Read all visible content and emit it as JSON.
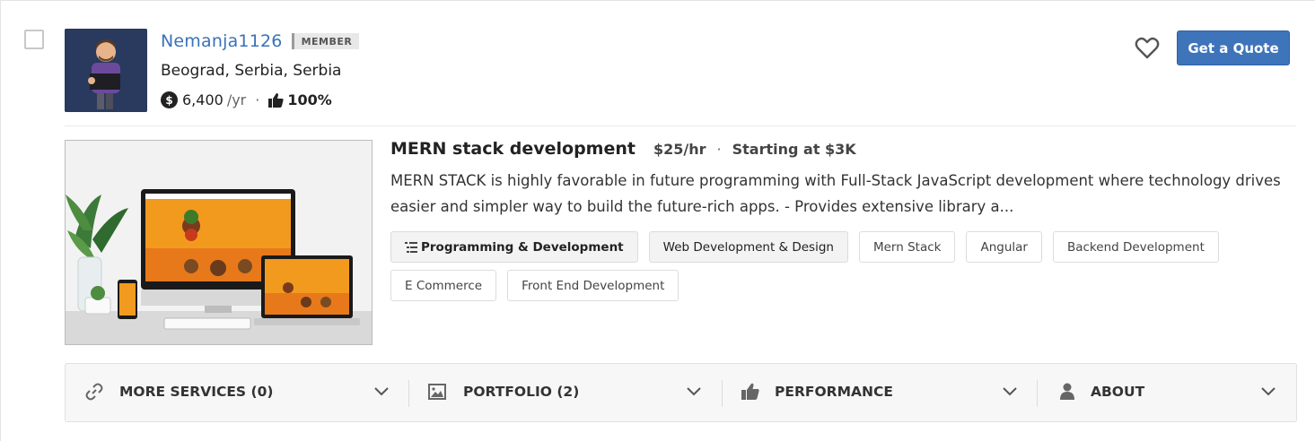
{
  "user": {
    "username": "Nemanja1126",
    "badge": "MEMBER",
    "location": "Beograd, Serbia, Serbia",
    "earnings": "6,400",
    "earnings_period": "/yr",
    "rating": "100%"
  },
  "actions": {
    "quote_label": "Get a Quote"
  },
  "service": {
    "title": "MERN stack development",
    "rate": "$25/hr",
    "starting": "Starting at $3K",
    "description": "MERN STACK is highly favorable in future programming with Full-Stack JavaScript development where technology drives easier and simpler way to build the future-rich apps. - Provides extensive library a...",
    "tags": [
      "Programming & Development",
      "Web Development & Design",
      "Mern Stack",
      "Angular",
      "Backend Development",
      "E Commerce",
      "Front End Development"
    ]
  },
  "sections": [
    {
      "label": "MORE SERVICES (0)",
      "icon": "link-icon"
    },
    {
      "label": "PORTFOLIO (2)",
      "icon": "image-icon"
    },
    {
      "label": "PERFORMANCE",
      "icon": "thumbs-up-icon"
    },
    {
      "label": "ABOUT",
      "icon": "user-icon"
    }
  ],
  "colors": {
    "link_blue": "#3a72b8",
    "button_blue": "#3e74b9",
    "bar_bg": "#f7f7f7"
  }
}
